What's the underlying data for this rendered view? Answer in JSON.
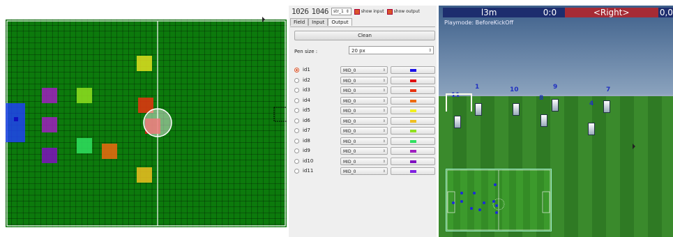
{
  "field": {
    "colors": {
      "background": "#0c7a0c",
      "grid": "#000000",
      "lines": "#ffffff",
      "goal": "#2040ff"
    },
    "circle_present": true
  },
  "panel": {
    "top": {
      "time_display": "1026",
      "cycle_display": "1046",
      "strategy_select": "str_1",
      "show_input_label": "show input",
      "show_output_label": "show output"
    },
    "tabs": [
      "Field",
      "Input",
      "Output"
    ],
    "active_tab": "Output",
    "clean_label": "Clean",
    "pen_size_label": "Pen size :",
    "pen_size_value": "20 px",
    "rows": [
      {
        "id": "id1",
        "pos": "MID_0",
        "color": "#1a10e8",
        "selected": true
      },
      {
        "id": "id2",
        "pos": "MID_0",
        "color": "#e01010"
      },
      {
        "id": "id3",
        "pos": "MID_0",
        "color": "#e83410"
      },
      {
        "id": "id4",
        "pos": "MID_0",
        "color": "#ee6a10"
      },
      {
        "id": "id5",
        "pos": "MID_0",
        "color": "#f0f020"
      },
      {
        "id": "id6",
        "pos": "MID_0",
        "color": "#f0c020"
      },
      {
        "id": "id7",
        "pos": "MID_0",
        "color": "#90e020"
      },
      {
        "id": "id8",
        "pos": "MID_0",
        "color": "#30e060"
      },
      {
        "id": "id9",
        "pos": "MID_0",
        "color": "#a020c0"
      },
      {
        "id": "id10",
        "pos": "MID_0",
        "color": "#8010c0"
      },
      {
        "id": "id11",
        "pos": "MID_0",
        "color": "#8020e0"
      }
    ]
  },
  "view3d": {
    "hud": {
      "left_team": "l3m",
      "score": "0:0",
      "right_team": "<Right>",
      "extra": "0,0"
    },
    "playmode": "Playmode: BeforeKickOff",
    "player_numbers": [
      "11",
      "1",
      "10",
      "9",
      "8",
      "4",
      "7"
    ]
  }
}
